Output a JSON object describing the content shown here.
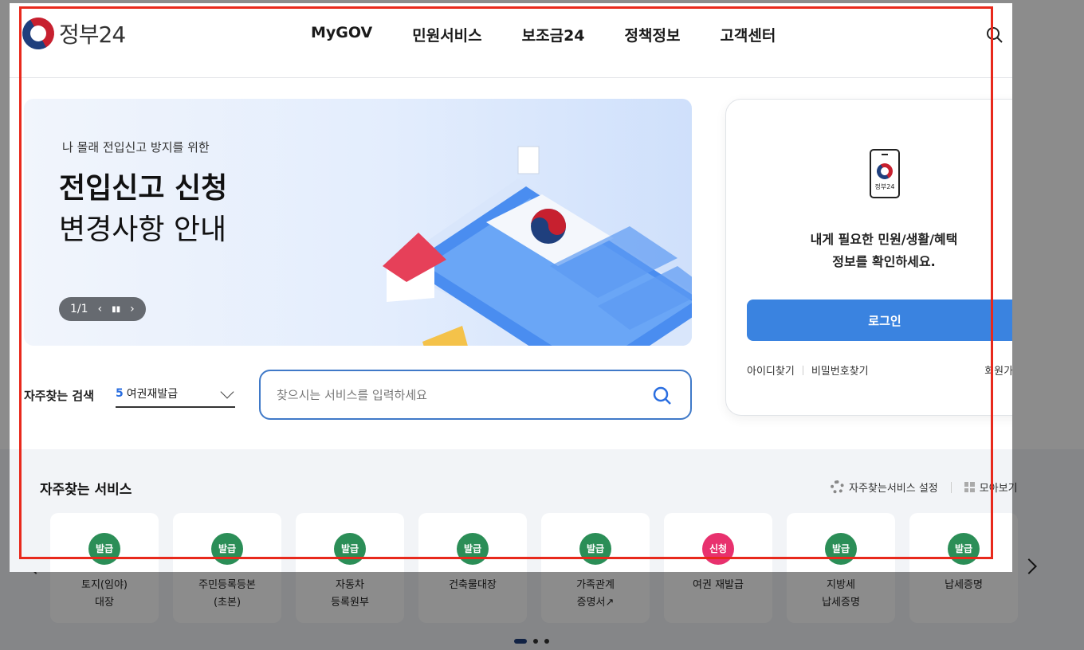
{
  "header": {
    "logo_text": "정부24",
    "nav": [
      "MyGOV",
      "민원서비스",
      "보조금24",
      "정책정보",
      "고객센터"
    ]
  },
  "banner": {
    "subtitle": "나 몰래 전입신고 방지를 위한",
    "title_line1": "전입신고 신청",
    "title_line2": "변경사항 안내",
    "pager": "1/1"
  },
  "search": {
    "freq_label": "자주찾는 검색",
    "freq_rank": "5",
    "freq_value": "여권재발급",
    "placeholder": "찾으시는 서비스를 입력하세요"
  },
  "login": {
    "phone_label": "정부24",
    "message_line1": "내게 필요한 민원/생활/혜택",
    "message_line2": "정보를 확인하세요.",
    "button": "로그인",
    "find_id": "아이디찾기",
    "find_pw": "비밀번호찾기",
    "join": "회원가입"
  },
  "services": {
    "title": "자주찾는 서비스",
    "settings": "자주찾는서비스 설정",
    "view_all": "모아보기",
    "items": [
      {
        "badge": "발급",
        "label": "토지(임야)\n대장"
      },
      {
        "badge": "발급",
        "label": "주민등록등본\n(초본)"
      },
      {
        "badge": "발급",
        "label": "자동차\n등록원부"
      },
      {
        "badge": "발급",
        "label": "건축물대장"
      },
      {
        "badge": "발급",
        "label": "가족관계\n증명서↗"
      },
      {
        "badge": "신청",
        "label": "여권 재발급"
      },
      {
        "badge": "발급",
        "label": "지방세\n납세증명"
      },
      {
        "badge": "발급",
        "label": "납세증명"
      }
    ]
  },
  "colors": {
    "accent": "#3a83e0",
    "issue_badge": "#2b8e57",
    "apply_badge": "#e8316e",
    "highlight_frame": "#e8291c"
  }
}
